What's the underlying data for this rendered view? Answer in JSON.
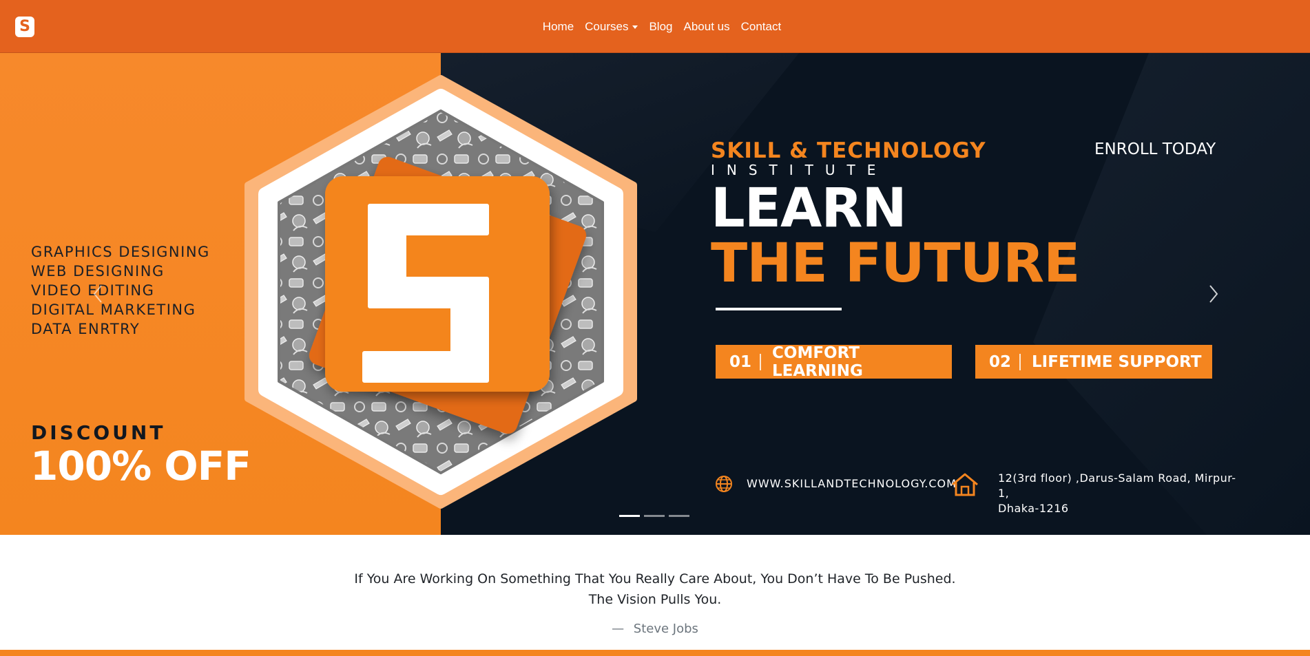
{
  "brand": {
    "logo_letter": "S"
  },
  "nav": {
    "items": [
      {
        "label": "Home"
      },
      {
        "label": "Courses",
        "dropdown": true
      },
      {
        "label": "Blog"
      },
      {
        "label": "About us"
      },
      {
        "label": "Contact"
      }
    ]
  },
  "hero": {
    "courses": [
      "GRAPHICS DESIGNING",
      "WEB DESIGNING",
      "VIDEO EDITING",
      "DIGITAL MARKETING",
      "DATA ENRTRY"
    ],
    "discount_label": "DISCOUNT",
    "discount_value": "100% OFF",
    "brand_line": "SKILL & TECHNOLOGY",
    "brand_sub": "INSTITUTE",
    "headline_1": "LEARN",
    "headline_2": "THE FUTURE",
    "enroll": "ENROLL TODAY",
    "features": [
      {
        "num": "01",
        "label": "COMFORT LEARNING"
      },
      {
        "num": "02",
        "label": "LIFETIME SUPPORT"
      }
    ],
    "website": "WWW.SKILLANDTECHNOLOGY.COM",
    "address_line1": "12(3rd floor) ,Darus-Salam Road, Mirpur-1,",
    "address_line2": "Dhaka-1216",
    "logo_letter": "S",
    "slide_count": 3,
    "active_slide": 1
  },
  "quote": {
    "line1": "If You Are Working On Something That You Really Care About, You Don’t Have To Be Pushed.",
    "line2": "The Vision Pulls You.",
    "dash": "—",
    "author": "Steve Jobs"
  },
  "colors": {
    "navbar": "#e4621e",
    "accent": "#f4851f",
    "dark": "#0a1420"
  }
}
